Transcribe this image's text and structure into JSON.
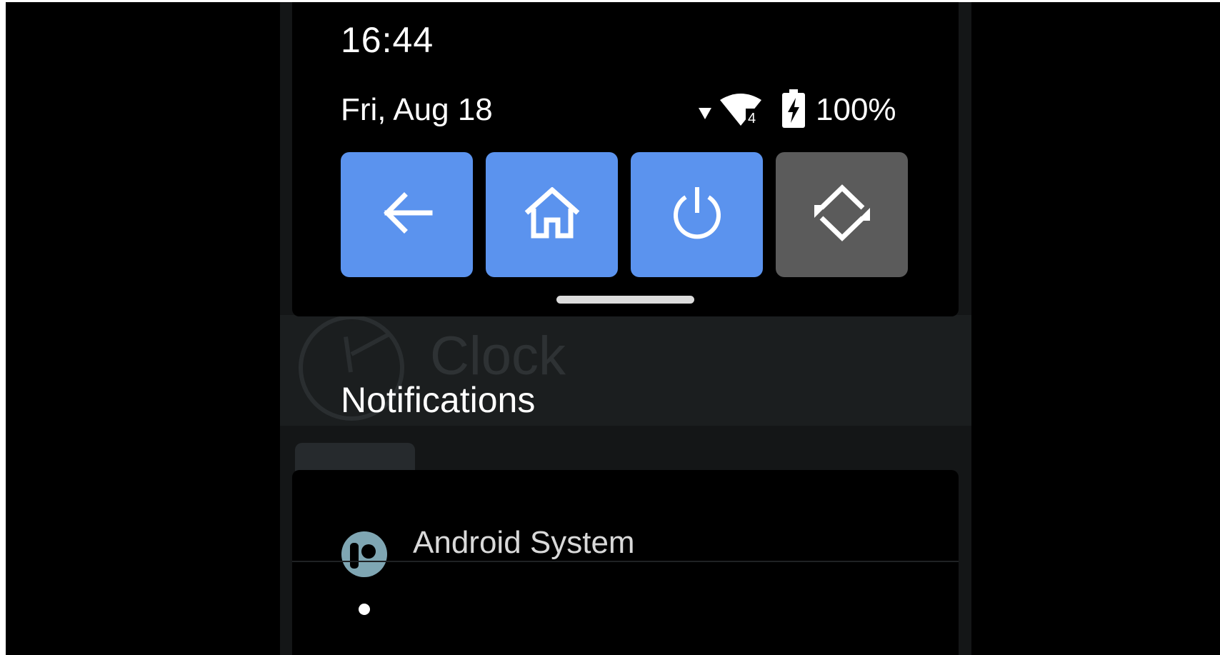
{
  "status_bar": {
    "time": "16:44",
    "date": "Fri, Aug 18",
    "battery_percent": "100%",
    "wifi_badge": "4",
    "icons": [
      "signal-arrow-icon",
      "wifi-icon",
      "battery-charging-icon"
    ]
  },
  "quick_settings": {
    "tiles": [
      {
        "name": "back",
        "icon": "back-arrow-icon",
        "active": true
      },
      {
        "name": "home",
        "icon": "home-icon",
        "active": true
      },
      {
        "name": "power",
        "icon": "power-icon",
        "active": true
      },
      {
        "name": "auto-rotate",
        "icon": "rotate-icon",
        "active": false
      }
    ],
    "colors": {
      "active": "#5b93ee",
      "inactive": "#5b5b5b"
    }
  },
  "background_app": {
    "title": "Clock"
  },
  "notifications": {
    "header": "Notifications",
    "items": [
      {
        "app_name": "Android System",
        "icon": "android-system-icon"
      }
    ]
  }
}
